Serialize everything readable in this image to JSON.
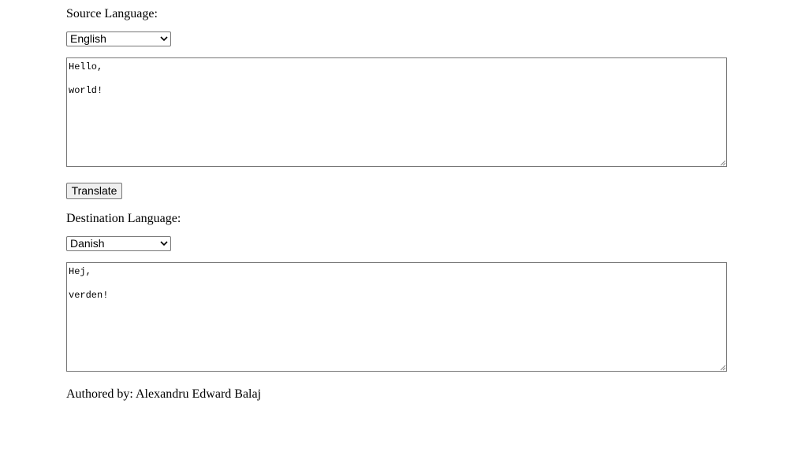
{
  "source": {
    "label": "Source Language:",
    "selected_language": "English",
    "text_lines": [
      "Hello,",
      "",
      "world!"
    ]
  },
  "translate_button": {
    "label": "Translate"
  },
  "destination": {
    "label": "Destination Language:",
    "selected_language": "Danish",
    "text_lines": [
      "Hej,",
      "",
      "verden!"
    ]
  },
  "footer": {
    "author_text": "Authored by: Alexandru Edward Balaj"
  },
  "icons": {
    "dropdown": "chevron-down-icon",
    "resize": "resize-grip-icon"
  }
}
